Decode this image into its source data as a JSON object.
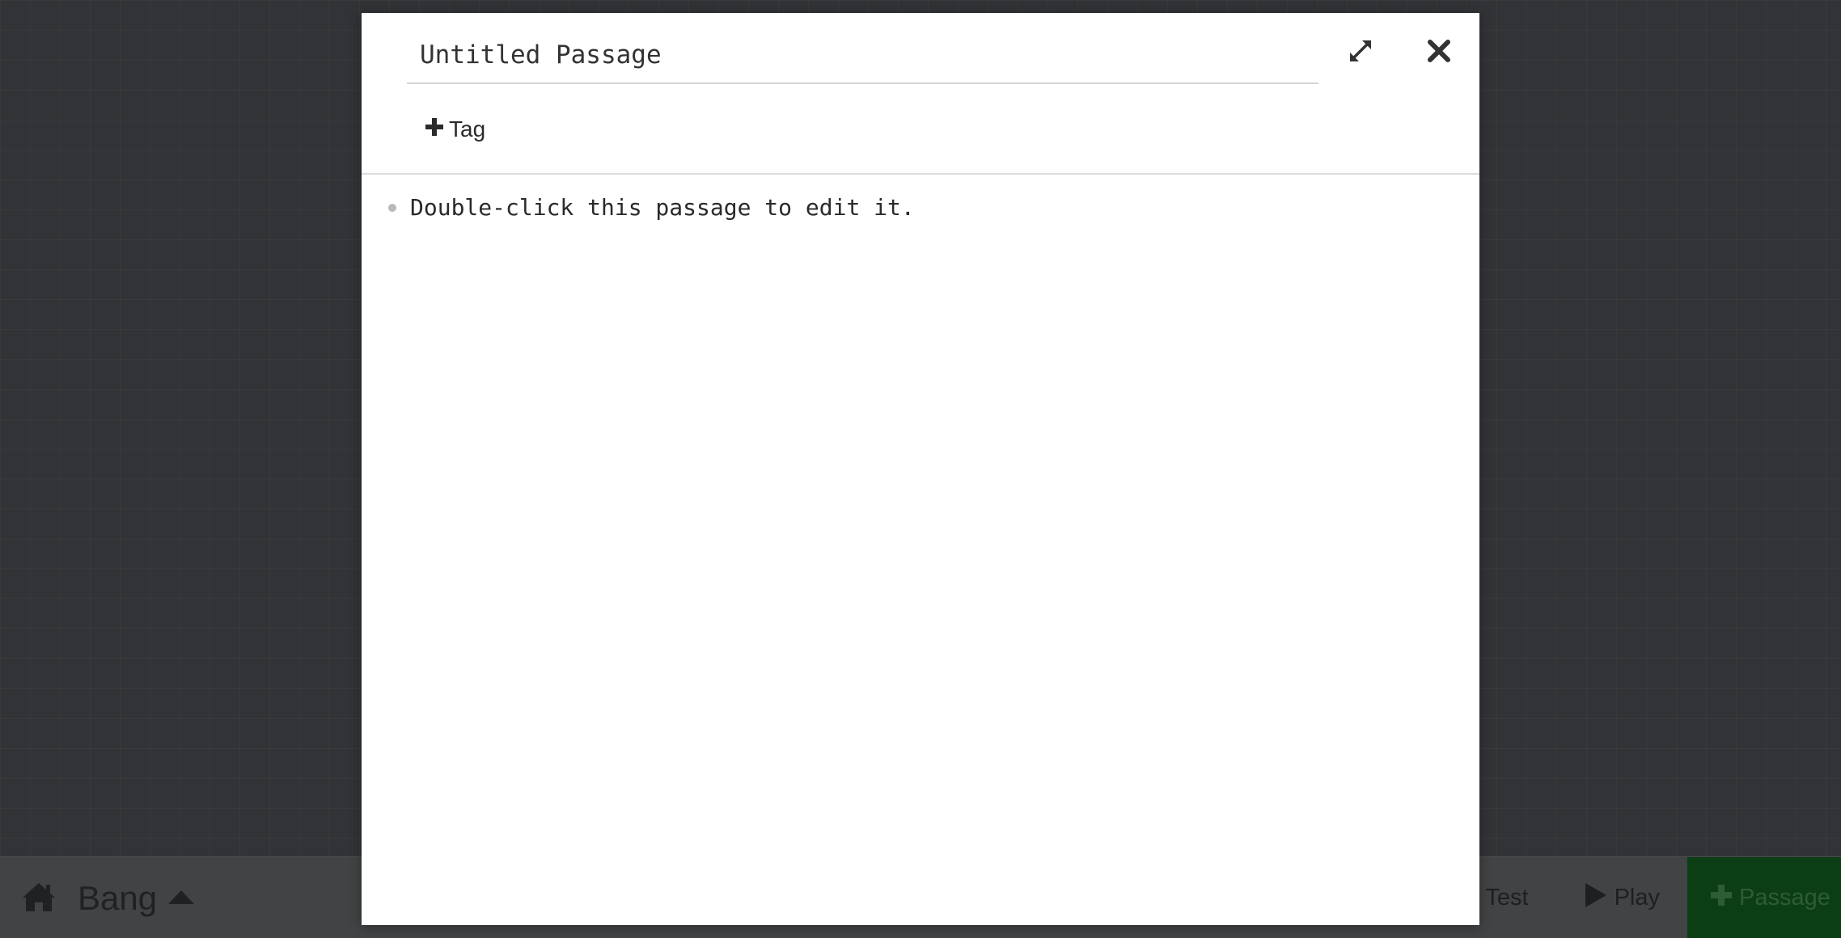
{
  "toolbar": {
    "home_icon": "home-icon",
    "story_title": "Bang",
    "story_menu_icon": "caret-up-icon",
    "test_label": "Test",
    "test_icon": "bug-icon",
    "play_label": "Play",
    "play_icon": "play-icon",
    "new_passage_label": "Passage",
    "new_passage_icon": "plus-icon"
  },
  "dialog": {
    "passage_name": "Untitled Passage",
    "maximize_icon": "expand-icon",
    "close_icon": "close-icon",
    "add_tag_label": "Tag",
    "add_tag_icon": "plus-icon",
    "body_text": "Double-click this passage to edit it."
  },
  "colors": {
    "background": "#383a3d",
    "toolbar": "#414345",
    "passage_button": "#0c3e15",
    "dialog": "#ffffff"
  }
}
